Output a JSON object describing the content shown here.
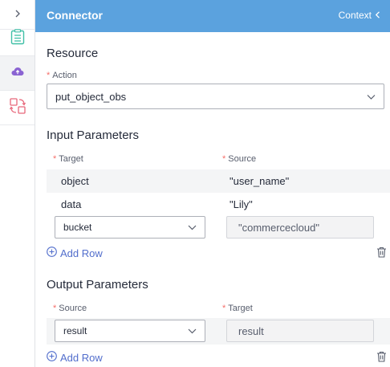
{
  "panel": {
    "title": "Connector",
    "context_label": "Context"
  },
  "resource": {
    "section_title": "Resource",
    "action_label": "Action",
    "action_value": "put_object_obs"
  },
  "input": {
    "section_title": "Input Parameters",
    "target_label": "Target",
    "source_label": "Source",
    "rows": [
      {
        "target": "object",
        "source": "\"user_name\""
      },
      {
        "target": "data",
        "source": "\"Lily\""
      }
    ],
    "edit_row": {
      "target": "bucket",
      "source": "\"commercecloud\""
    },
    "add_row_label": "Add Row"
  },
  "output": {
    "section_title": "Output Parameters",
    "source_label": "Source",
    "target_label": "Target",
    "edit_row": {
      "source": "result",
      "target": "result"
    },
    "add_row_label": "Add Row"
  },
  "colors": {
    "header": "#5ba2de",
    "accent": "#526ecc",
    "required": "#f66f6a",
    "icon_teal": "#3fbfa6",
    "icon_purple": "#8a63d2",
    "icon_red": "#e8677a"
  },
  "icons": [
    "chevron-right-icon",
    "clipboard-list-icon",
    "cloud-upload-icon",
    "swap-icon",
    "chevron-left-icon",
    "chevron-down-icon",
    "add-circle-icon",
    "trash-icon"
  ]
}
